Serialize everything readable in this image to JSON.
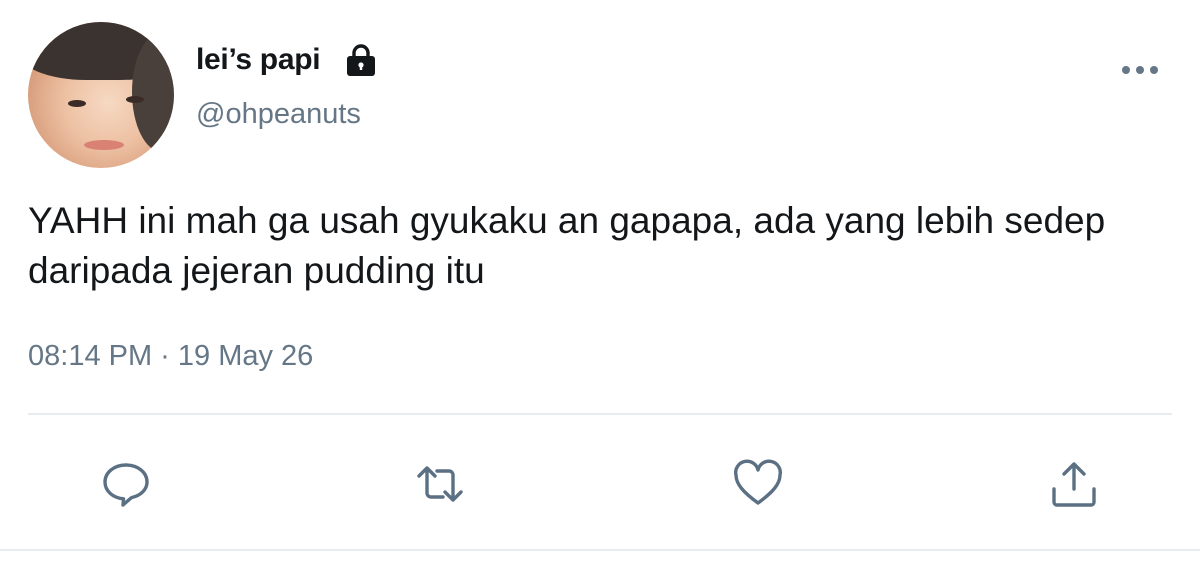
{
  "tweet": {
    "display_name": "lei’s papi",
    "handle": "@ohpeanuts",
    "text": "YAHH ini mah ga usah gyukaku an gapapa, ada yang lebih sedep daripada jejeran pudding itu",
    "timestamp": "08:14 PM · 19 May 26",
    "protected_icon": "lock-icon",
    "more_icon": "more-dots-icon"
  },
  "actions": [
    {
      "icon": "reply-icon"
    },
    {
      "icon": "retweet-icon"
    },
    {
      "icon": "like-icon"
    },
    {
      "icon": "share-icon"
    }
  ],
  "colors": {
    "text": "#14171a",
    "secondary": "#657786",
    "icon": "#5b7083",
    "divider": "#e6ecf0"
  }
}
